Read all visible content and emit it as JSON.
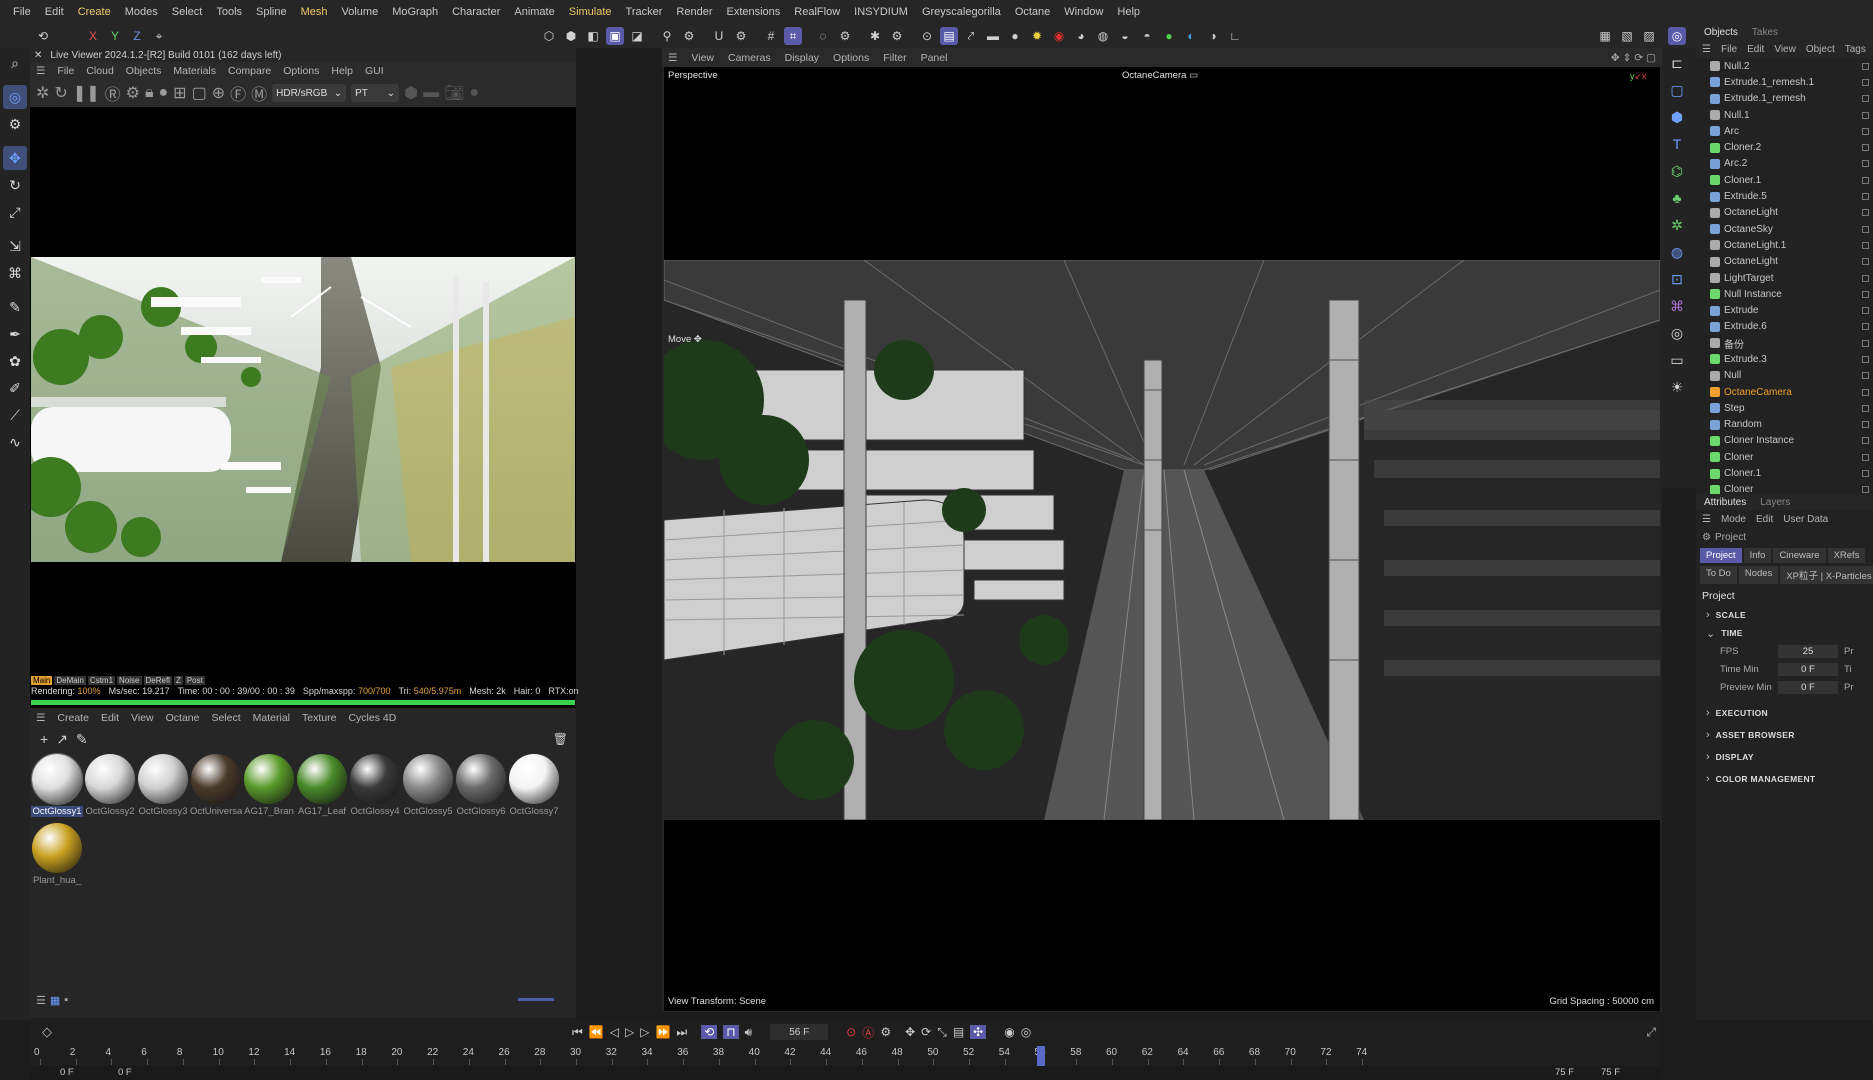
{
  "menu": [
    "File",
    "Edit",
    "Create",
    "Modes",
    "Select",
    "Tools",
    "Spline",
    "Mesh",
    "Volume",
    "MoGraph",
    "Character",
    "Animate",
    "Simulate",
    "Tracker",
    "Render",
    "Extensions",
    "RealFlow",
    "INSYDIUM",
    "Greyscalegorilla",
    "Octane",
    "Window",
    "Help"
  ],
  "live_viewer": {
    "title": "Live Viewer 2024.1.2-[R2] Build 0101 (162 days left)",
    "menu": [
      "File",
      "Cloud",
      "Objects",
      "Materials",
      "Compare",
      "Options",
      "Help",
      "GUI"
    ],
    "colorspace": "HDR/sRGB",
    "kernel": "PT",
    "status_cells": [
      "Main",
      "DeMain",
      "Cstm1",
      "Noise",
      "DeRefl",
      "Z",
      "Post"
    ],
    "stats": {
      "rendering_label": "Rendering:",
      "rendering": "100%",
      "ms_label": "Ms/sec:",
      "ms": "19.217",
      "time_label": "Time:",
      "time": "00 : 00 : 39/00 : 00 : 39",
      "spp_label": "Spp/maxspp:",
      "spp": "700/700",
      "tri_label": "Tri:",
      "tri": "540/5.975m",
      "mesh_label": "Mesh:",
      "mesh": "2k",
      "hair_label": "Hair:",
      "hair": "0",
      "rtx_label": "RTX:",
      "rtx": "on"
    }
  },
  "material_manager": {
    "menu": [
      "Create",
      "Edit",
      "View",
      "Octane",
      "Select",
      "Material",
      "Texture",
      "Cycles 4D"
    ],
    "materials": [
      {
        "name": "OctGlossy1",
        "color": "#e0e0e0",
        "selected": true
      },
      {
        "name": "OctGlossy2",
        "color": "#d8d8d8"
      },
      {
        "name": "OctGlossy3",
        "color": "#d0d0d0"
      },
      {
        "name": "OctUniversal",
        "color": "#4a3a2a"
      },
      {
        "name": "AG17_Bran",
        "color": "#5a9a2a"
      },
      {
        "name": "AG17_Leaf",
        "color": "#4a8a2a"
      },
      {
        "name": "OctGlossy4",
        "color": "#3a3a3a"
      },
      {
        "name": "OctGlossy5",
        "color": "#8a8a8a"
      },
      {
        "name": "OctGlossy6",
        "color": "#6a6a6a"
      },
      {
        "name": "OctGlossy7",
        "color": "#f4f4f4"
      },
      {
        "name": "Plant_hua_",
        "color": "#c8a020"
      }
    ]
  },
  "viewport": {
    "menu": [
      "View",
      "Cameras",
      "Display",
      "Options",
      "Filter",
      "Panel"
    ],
    "label": "Perspective",
    "camera": "OctaneCamera",
    "move_label": "Move",
    "view_transform": "View Transform: Scene",
    "grid_spacing": "Grid Spacing : 50000 cm"
  },
  "objects_panel": {
    "tabs": [
      "Objects",
      "Takes"
    ],
    "menu": [
      "File",
      "Edit",
      "View",
      "Object",
      "Tags"
    ],
    "items": [
      {
        "name": "Null.2",
        "color": "#aaaaaa"
      },
      {
        "name": "Extrude.1_remesh.1",
        "color": "#7aa0d8"
      },
      {
        "name": "Extrude.1_remesh",
        "color": "#7aa0d8"
      },
      {
        "name": "Null.1",
        "color": "#aaaaaa"
      },
      {
        "name": "Arc",
        "color": "#7aa0d8"
      },
      {
        "name": "Cloner.2",
        "color": "#6bd86b"
      },
      {
        "name": "Arc.2",
        "color": "#7aa0d8"
      },
      {
        "name": "Cloner.1",
        "color": "#6bd86b"
      },
      {
        "name": "Extrude.5",
        "color": "#7aa0d8"
      },
      {
        "name": "OctaneLight",
        "color": "#aaaaaa"
      },
      {
        "name": "OctaneSky",
        "color": "#7aa0d8"
      },
      {
        "name": "OctaneLight.1",
        "color": "#aaaaaa"
      },
      {
        "name": "OctaneLight",
        "color": "#aaaaaa"
      },
      {
        "name": "LightTarget",
        "color": "#aaaaaa"
      },
      {
        "name": "Null Instance",
        "color": "#6bd86b"
      },
      {
        "name": "Extrude",
        "color": "#7aa0d8"
      },
      {
        "name": "Extrude.6",
        "color": "#7aa0d8"
      },
      {
        "name": "备份",
        "color": "#aaaaaa"
      },
      {
        "name": "Extrude.3",
        "color": "#6bd86b"
      },
      {
        "name": "Null",
        "color": "#aaaaaa"
      },
      {
        "name": "OctaneCamera",
        "color": "#f0a030",
        "highlight": true
      },
      {
        "name": "Step",
        "color": "#7aa0d8"
      },
      {
        "name": "Random",
        "color": "#7aa0d8"
      },
      {
        "name": "Cloner Instance",
        "color": "#6bd86b"
      },
      {
        "name": "Cloner",
        "color": "#6bd86b"
      },
      {
        "name": "Cloner.1",
        "color": "#6bd86b"
      },
      {
        "name": "Cloner",
        "color": "#6bd86b"
      }
    ]
  },
  "attributes_panel": {
    "tabs": [
      "Attributes",
      "Layers"
    ],
    "menu": [
      "Mode",
      "Edit",
      "User Data"
    ],
    "project_label": "Project",
    "buttons_row1": [
      "Project",
      "Info",
      "Cineware",
      "XRefs"
    ],
    "buttons_row2": [
      "To Do",
      "Nodes",
      "XP粒子 | X-Particles"
    ],
    "section_title": "Project",
    "sections": [
      "SCALE",
      "TIME",
      "EXECUTION",
      "ASSET BROWSER",
      "DISPLAY",
      "COLOR MANAGEMENT"
    ],
    "fields": [
      {
        "label": "FPS",
        "value": "25",
        "right": "Pr"
      },
      {
        "label": "Time Min",
        "value": "0 F",
        "right": "Ti"
      },
      {
        "label": "Preview Min",
        "value": "0 F",
        "right": "Pr"
      }
    ]
  },
  "timeline": {
    "current_frame": "56 F",
    "start": "0 F",
    "start2": "0 F",
    "end": "75 F",
    "end2": "75 F",
    "ticks": [
      "0",
      "2",
      "4",
      "6",
      "8",
      "10",
      "12",
      "14",
      "16",
      "18",
      "20",
      "22",
      "24",
      "26",
      "28",
      "30",
      "32",
      "34",
      "36",
      "38",
      "40",
      "42",
      "44",
      "46",
      "48",
      "50",
      "52",
      "54",
      "56",
      "58",
      "60",
      "62",
      "64",
      "66",
      "68",
      "70",
      "72",
      "74"
    ],
    "playhead": 56,
    "max": 75
  }
}
